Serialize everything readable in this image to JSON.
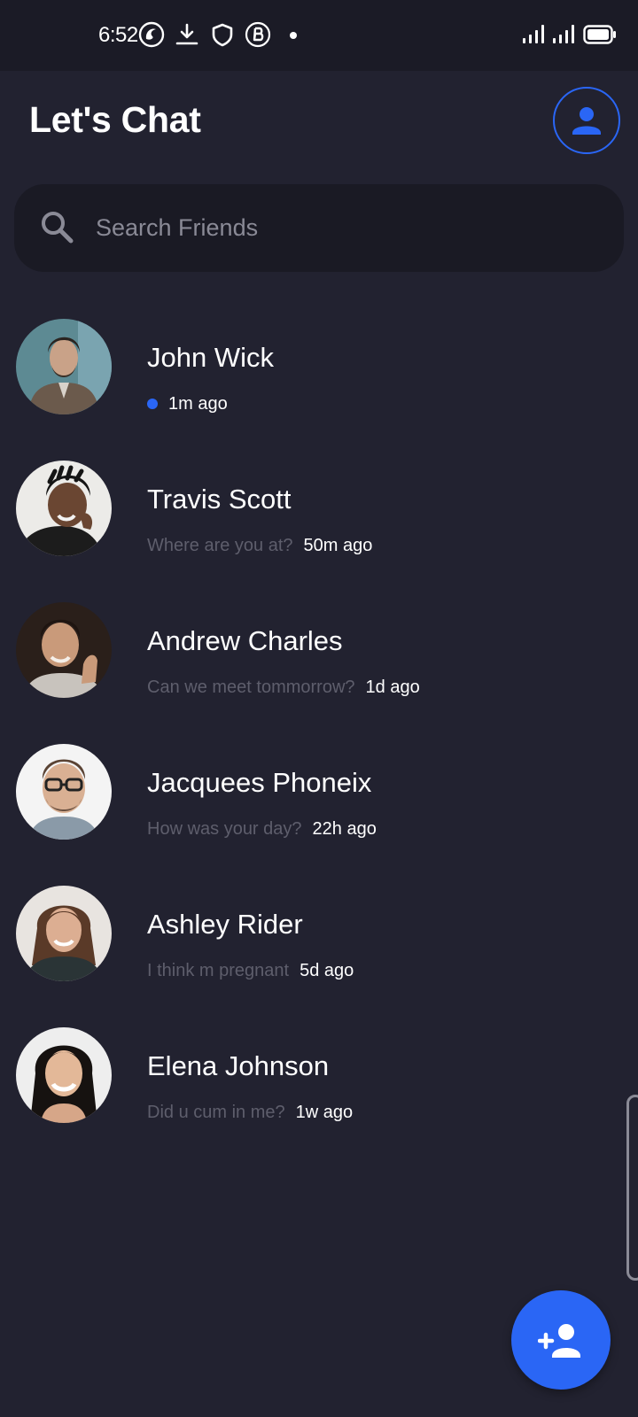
{
  "status_bar": {
    "time": "6:52",
    "icons": [
      "app-logo-icon",
      "download-icon",
      "shield-icon",
      "b-circle-icon",
      "notification-dot-icon",
      "signal-icon",
      "signal-icon",
      "battery-icon"
    ]
  },
  "header": {
    "title": "Let's Chat",
    "profile_icon": "person-icon"
  },
  "search": {
    "placeholder": "Search Friends",
    "value": ""
  },
  "friends": [
    {
      "name": "John Wick",
      "last_message": "",
      "time": "1m ago",
      "online": true
    },
    {
      "name": "Travis Scott",
      "last_message": "Where are you at?",
      "time": "50m ago",
      "online": false
    },
    {
      "name": "Andrew Charles",
      "last_message": "Can we meet tommorrow?",
      "time": "1d ago",
      "online": false
    },
    {
      "name": "Jacquees Phoneix",
      "last_message": "How was your day?",
      "time": "22h ago",
      "online": false
    },
    {
      "name": "Ashley Rider",
      "last_message": "I think m pregnant",
      "time": "5d ago",
      "online": false
    },
    {
      "name": "Elena Johnson",
      "last_message": "Did u cum in me?",
      "time": "1w ago",
      "online": false
    }
  ],
  "fab": {
    "icon": "add-person-icon"
  },
  "colors": {
    "background": "#222230",
    "status_bar": "#1b1b26",
    "search_bg": "#1a1a24",
    "accent": "#2a66f5",
    "muted_text": "#5e5e6c"
  }
}
